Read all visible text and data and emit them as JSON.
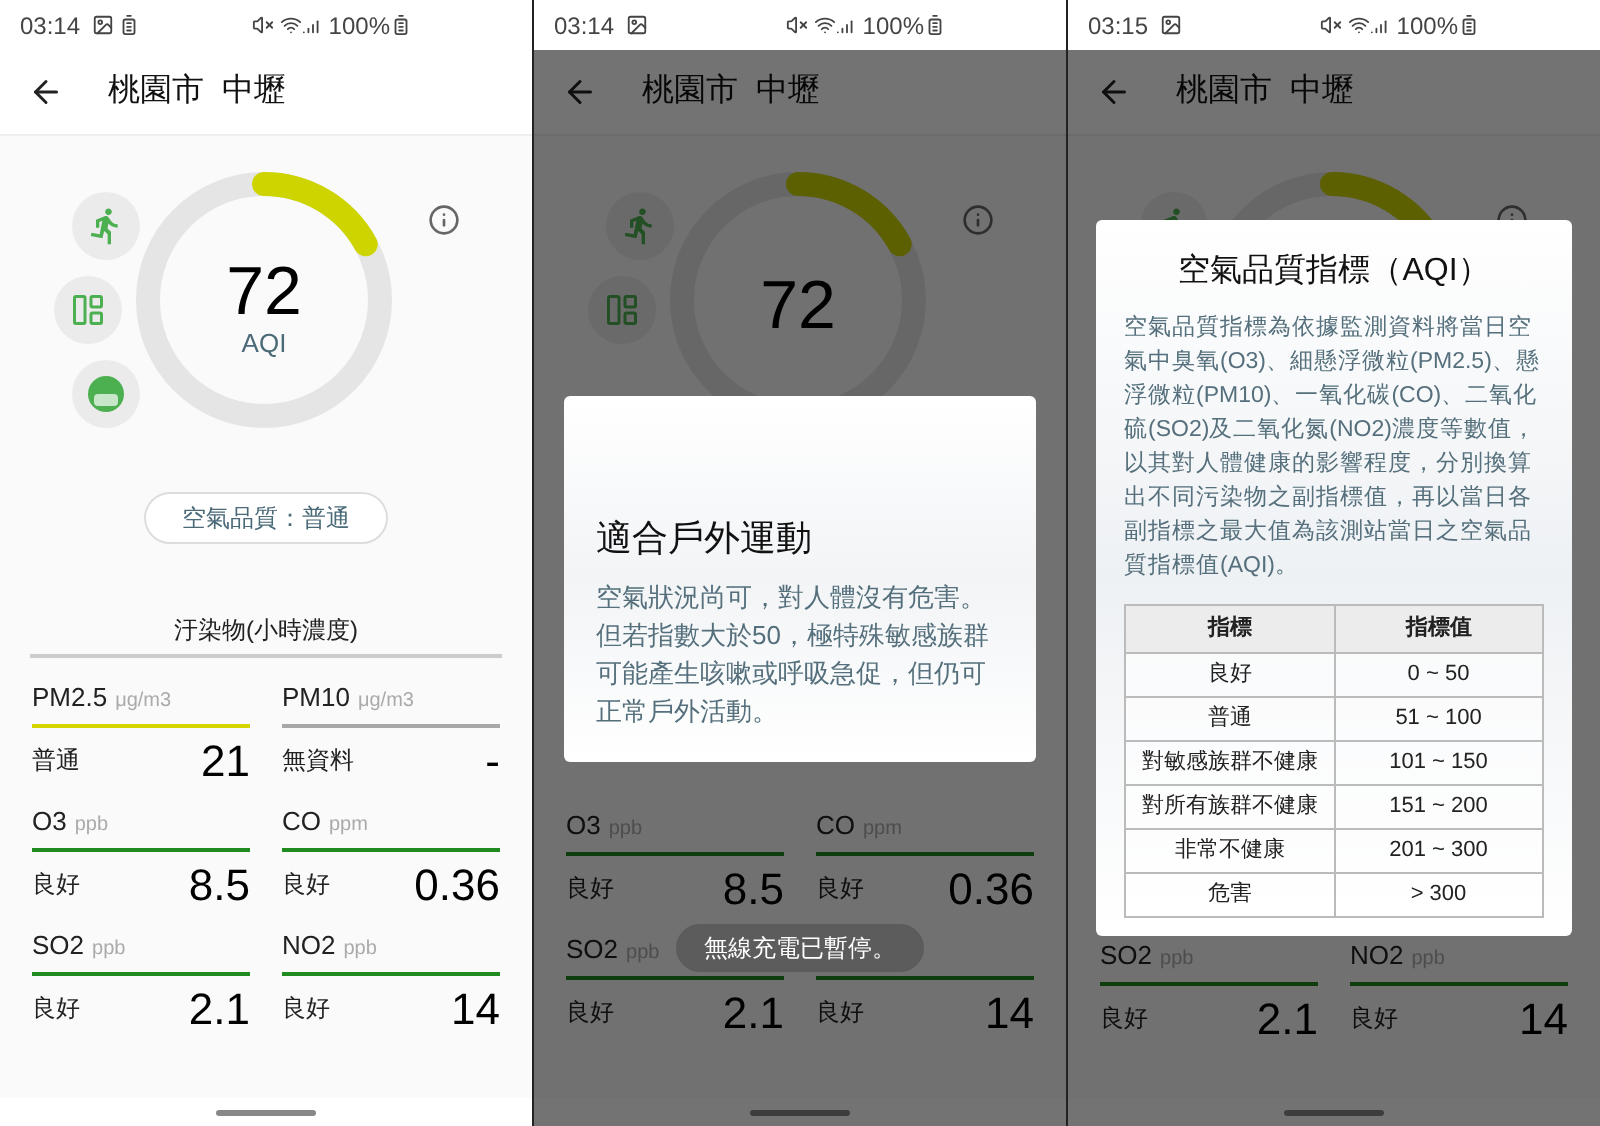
{
  "screens": [
    {
      "status_bar": {
        "time": "03:14",
        "battery_notification": true,
        "battery": "100%"
      },
      "title": "桃園市  中壢",
      "dimmed": false,
      "gauge": {
        "level": 0.17,
        "value": "72",
        "label": "AQI"
      },
      "quality": "空氣品質：普通",
      "pollutants_title": "汙染物(小時濃度)",
      "pollutants": [
        {
          "name": "PM2.5",
          "unit": "μg/m3",
          "status": "普通",
          "value": "21",
          "color": "#d4d400"
        },
        {
          "name": "PM10",
          "unit": "μg/m3",
          "status": "無資料",
          "value": "-",
          "color": "#a8a8a8"
        },
        {
          "name": "O3",
          "unit": "ppb",
          "status": "良好",
          "value": "8.5",
          "color": "#1f8a1f"
        },
        {
          "name": "CO",
          "unit": "ppm",
          "status": "良好",
          "value": "0.36",
          "color": "#1f8a1f"
        },
        {
          "name": "SO2",
          "unit": "ppb",
          "status": "良好",
          "value": "2.1",
          "color": "#1f8a1f"
        },
        {
          "name": "NO2",
          "unit": "ppb",
          "status": "良好",
          "value": "14",
          "color": "#1f8a1f"
        }
      ]
    },
    {
      "status_bar": {
        "time": "03:14",
        "battery_notification": false,
        "battery": "100%"
      },
      "title": "桃園市  中壢",
      "dimmed": true,
      "gauge": {
        "level": 0.17,
        "value": "72"
      },
      "dialog": {
        "kind": "advice",
        "title": "適合戶外運動",
        "body": "空氣狀況尚可，對人體沒有危害。但若指數大於50，極特殊敏感族群可能產生咳嗽或呼吸急促，但仍可正常戶外活動。"
      },
      "pollutants": [
        {
          "name": "O3",
          "unit": "ppb",
          "status": "良好",
          "value": "8.5",
          "color": "#0e3e0e"
        },
        {
          "name": "CO",
          "unit": "ppm",
          "status": "良好",
          "value": "0.36",
          "color": "#0e3e0e"
        },
        {
          "name": "SO2",
          "unit": "ppb",
          "status": "良好",
          "value": "2.1",
          "color": "#0e3e0e"
        },
        {
          "status": "良好",
          "value": "14",
          "color": "#0e3e0e"
        }
      ],
      "toast": "無線充電已暫停。"
    },
    {
      "status_bar": {
        "time": "03:15",
        "battery_notification": false,
        "battery": "100%"
      },
      "title": "桃園市  中壢",
      "dimmed": true,
      "gauge": {
        "level": 0.17
      },
      "dialog": {
        "kind": "table",
        "title": "空氣品質指標（AQI）",
        "body": "空氣品質指標為依據監測資料將當日空氣中臭氧(O3)、細懸浮微粒(PM2.5)、懸浮微粒(PM10)、一氧化碳(CO)、二氧化硫(SO2)及二氧化氮(NO2)濃度等數值，以其對人體健康的影響程度，分別換算出不同污染物之副指標值，再以當日各副指標之最大值為該測站當日之空氣品質指標值(AQI)。",
        "table": {
          "columns": [
            "指標",
            "指標值"
          ],
          "rows": [
            [
              "良好",
              "0 ~ 50"
            ],
            [
              "普通",
              "51 ~ 100"
            ],
            [
              "對敏感族群不健康",
              "101 ~ 150"
            ],
            [
              "對所有族群不健康",
              "151 ~ 200"
            ],
            [
              "非常不健康",
              "201 ~ 300"
            ],
            [
              "危害",
              "> 300"
            ]
          ]
        }
      },
      "pollutants": [
        {
          "name": "SO2",
          "unit": "ppb",
          "status": "良好",
          "value": "2.1",
          "color": "#0e3e0e"
        },
        {
          "name": "NO2",
          "unit": "ppb",
          "status": "良好",
          "value": "14",
          "color": "#0e3e0e"
        }
      ]
    }
  ]
}
